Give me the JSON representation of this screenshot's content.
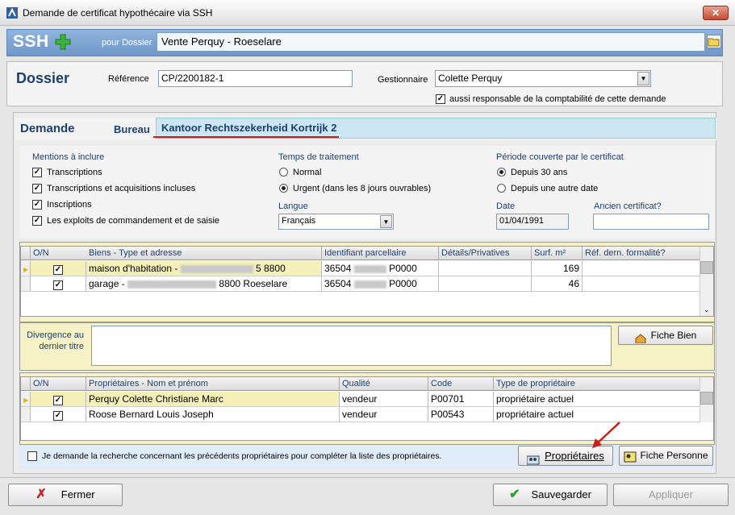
{
  "window": {
    "title": "Demande de certificat hypothécaire via SSH",
    "close_label": "✕"
  },
  "header": {
    "brand": "SSH",
    "pour_dossier_label": "pour Dossier",
    "dossier_value": "Vente Perquy - Roeselare"
  },
  "dossier": {
    "heading": "Dossier",
    "reference_label": "Référence",
    "reference_value": "CP/2200182-1",
    "gestionnaire_label": "Gestionnaire",
    "gestionnaire_value": "Colette Perquy",
    "responsable_label": "aussi responsable de la comptabilité de cette demande",
    "responsable_checked": true
  },
  "demande": {
    "heading": "Demande",
    "bureau_label": "Bureau",
    "bureau_value": "Kantoor Rechtszekerheid Kortrijk 2",
    "mentions_title": "Mentions à inclure",
    "mentions": [
      {
        "label": "Transcriptions",
        "checked": true
      },
      {
        "label": "Transcriptions et acquisitions incluses",
        "checked": true
      },
      {
        "label": "Inscriptions",
        "checked": true
      },
      {
        "label": "Les exploits de commandement et de saisie",
        "checked": true
      }
    ],
    "temps_title": "Temps de traitement",
    "temps": [
      {
        "label": "Normal",
        "selected": false
      },
      {
        "label": "Urgent (dans les 8 jours ouvrables)",
        "selected": true
      }
    ],
    "langue_label": "Langue",
    "langue_value": "Français",
    "periode_title": "Période couverte par le certificat",
    "periode": [
      {
        "label": "Depuis 30 ans",
        "selected": true
      },
      {
        "label": "Depuis une autre date",
        "selected": false
      }
    ],
    "date_label": "Date",
    "date_value": "01/04/1991",
    "ancien_label": "Ancien certificat?",
    "ancien_value": ""
  },
  "biens": {
    "columns": [
      "O/N",
      "Biens - Type et adresse",
      "Identifiant parcellaire",
      "Détails/Privatives",
      "Surf. m²",
      "Réf. dern. formalité?"
    ],
    "rows": [
      {
        "checked": true,
        "type": "maison d'habitation",
        "addr_suffix": "5  8800",
        "id_prefix": "36504",
        "id_suffix": "P0000",
        "details": "",
        "surf": "169",
        "ref": ""
      },
      {
        "checked": true,
        "type": "garage",
        "addr_suffix": "8800 Roeselare",
        "id_prefix": "36504",
        "id_suffix": "P0000",
        "details": "",
        "surf": "46",
        "ref": ""
      }
    ],
    "divergence_label_1": "Divergence au",
    "divergence_label_2": "dernier titre",
    "divergence_value": "",
    "fiche_bien_label": "Fiche Bien"
  },
  "proprietaires": {
    "columns": [
      "O/N",
      "Propriétaires - Nom et prénom",
      "Qualité",
      "Code",
      "Type de propriétaire"
    ],
    "rows": [
      {
        "checked": true,
        "nom": "Perquy Colette Christiane Marc",
        "qualite": "vendeur",
        "code": "P00701",
        "type": "propriétaire actuel"
      },
      {
        "checked": true,
        "nom": "Roose Bernard Louis Joseph",
        "qualite": "vendeur",
        "code": "P00543",
        "type": "propriétaire actuel"
      }
    ],
    "recherche_label": "Je demande la recherche concernant les précédents propriétaires pour compléter la liste des propriétaires.",
    "recherche_checked": false,
    "proprietaires_btn": "Propriétaires",
    "fiche_personne_btn": "Fiche Personne"
  },
  "footer": {
    "fermer": "Fermer",
    "sauvegarder": "Sauvegarder",
    "appliquer": "Appliquer"
  },
  "colors": {
    "accent": "#1d3f6e",
    "header_blue": "#7aa0d0",
    "selected_row": "#fbf6b0",
    "green_check": "#2a9d2a",
    "red_arrow": "#d21b1b"
  }
}
